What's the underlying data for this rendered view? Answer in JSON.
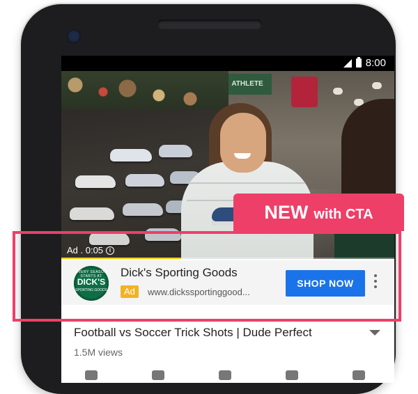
{
  "status_bar": {
    "time": "8:00"
  },
  "video": {
    "ad_time": "Ad . 0:05",
    "info_icon": "info-icon",
    "progress": 0.36,
    "store_banner": "ATHLETE"
  },
  "ad_card": {
    "advertiser": "Dick's Sporting Goods",
    "badge": "Ad",
    "url": "www.dickssportinggood...",
    "cta": "SHOP NOW",
    "logo": {
      "main": "DICK'S",
      "top": "EVERY SEASON STARTS AT",
      "bottom": "SPORTING GOODS"
    },
    "menu_icon": "more-vert-icon"
  },
  "video_info": {
    "title": "Football vs Soccer Trick Shots | Dude Perfect",
    "views": "1.5M views"
  },
  "promo": {
    "big": "NEW",
    "small": "with CTA"
  },
  "colors": {
    "accent": "#ee3f68",
    "cta": "#1a73e8",
    "badge": "#f2b322",
    "progress": "#ffcc00"
  }
}
